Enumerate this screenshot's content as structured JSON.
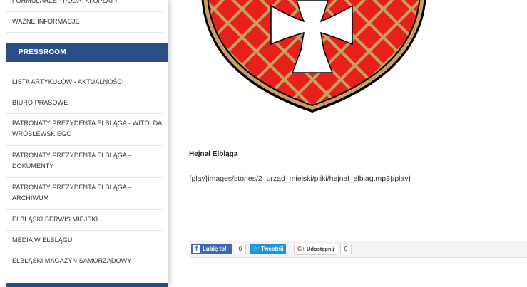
{
  "sidebar": {
    "items_top": [
      {
        "label": "FORMULARZE - PODATKI OPŁATY"
      },
      {
        "label": "WAŻNE INFORMACJE"
      }
    ],
    "section_header": "PRESSROOM",
    "items": [
      {
        "line1": "LISTA ARTYKUŁÓW - AKTUALNOŚCI",
        "line2": ""
      },
      {
        "line1": "BIURO PRASOWE",
        "line2": ""
      },
      {
        "line1": "PATRONATY PREZYDENTA ELBLĄGA - WITOLDA",
        "line2": "WRÓBLEWSKIEGO"
      },
      {
        "line1": "PATRONATY PREZYDENTA ELBLĄGA -",
        "line2": "DOKUMENTY"
      },
      {
        "line1": "PATRONATY PREZYDENTA ELBLĄGA -",
        "line2": "ARCHIWUM"
      },
      {
        "line1": "ELBLĄSKI SERWIS MIEJSKI",
        "line2": ""
      },
      {
        "line1": "MEDIA W ELBLĄGU",
        "line2": ""
      },
      {
        "line1": "ELBLĄSKI MAGAZYN SAMORZĄDOWY",
        "line2": ""
      }
    ]
  },
  "main": {
    "title": "Hejnał Elbląga",
    "play_tag": "{play}images/stories/2_urzad_miejski/pliki/hejnal_elblag.mp3{/play}"
  },
  "social": {
    "facebook": {
      "label": "Lubię to!",
      "count": "0",
      "icon": "facebook-icon"
    },
    "twitter": {
      "label": "Tweetnij",
      "icon": "twitter-bird-icon"
    },
    "google": {
      "label": "Udostępnij",
      "count": "0",
      "icon": "google-plus-icon",
      "icon_text": "G+"
    }
  },
  "colors": {
    "brand_blue": "#2b4e86",
    "crest_red": "#e8201c",
    "crest_gold": "#c8a060"
  }
}
